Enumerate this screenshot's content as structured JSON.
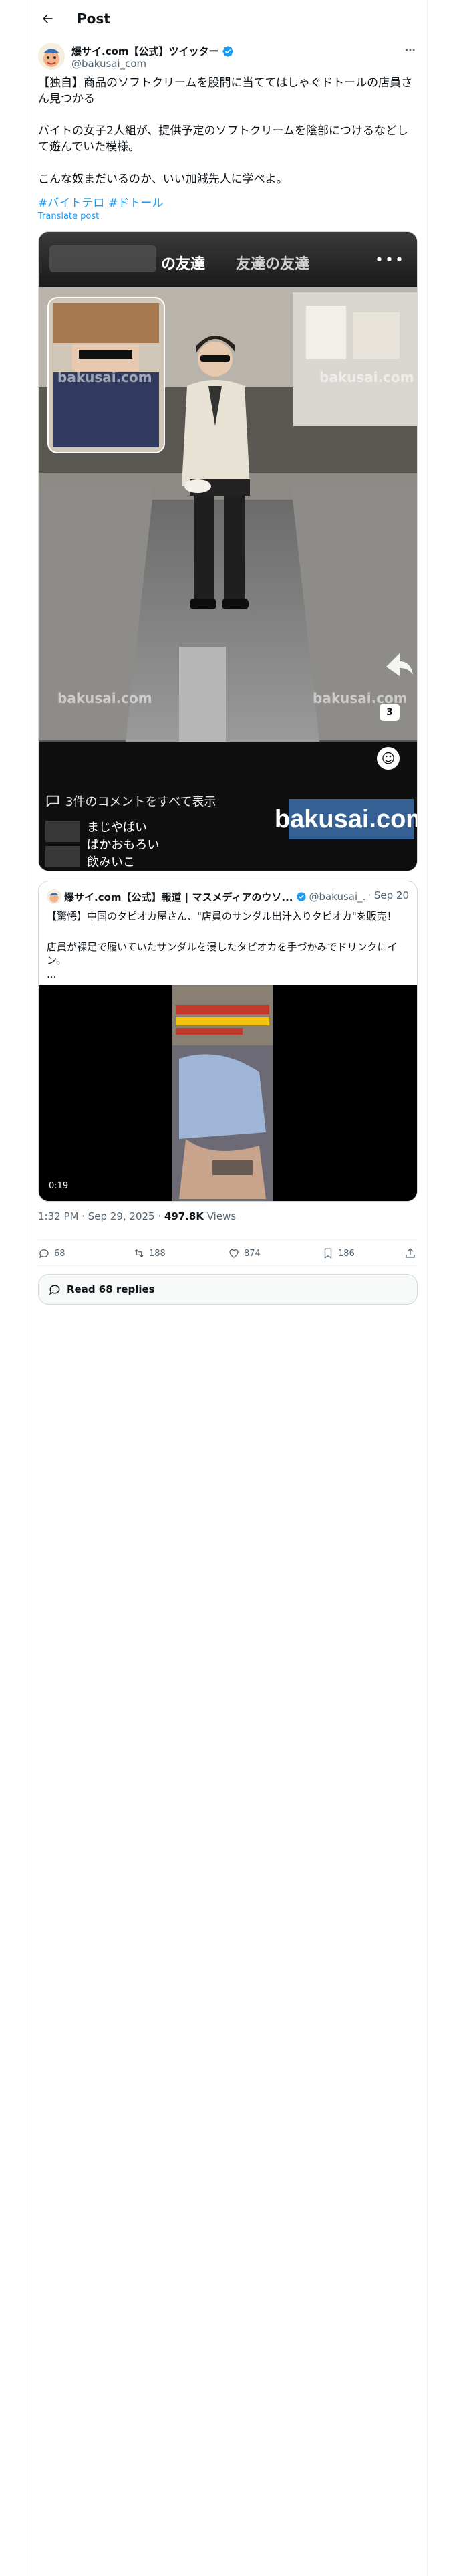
{
  "header": {
    "title": "Post",
    "back_icon": "arrow-left-icon"
  },
  "author": {
    "name": "爆サイ.com【公式】ツイッター",
    "handle": "@bakusai_com",
    "verified": true,
    "verified_color": "#1d9bf0"
  },
  "post": {
    "text": "【独自】商品のソフトクリームを股間に当ててはしゃぐドトールの店員さん見つかる\n\nバイトの女子2人組が、提供予定のソフトクリームを陰部につけるなどして遊んでいた模様。\n\nこんな奴まだいるのか、いい加減先人に学べよ。",
    "hashtags": [
      "#バイトテロ",
      "#ドトール"
    ],
    "translate_label": "Translate post"
  },
  "media": {
    "tab_friends": "の友達",
    "tab_friends_of_friends": "友達の友達",
    "comments_link": "3件のコメントをすべて表示",
    "comments": [
      "まじやばい",
      "ばかおもろい",
      "飲みいこ"
    ],
    "badge_count": "3",
    "watermark": "bakusai.com",
    "watermark_logo": "bakusai.com"
  },
  "quote": {
    "name": "爆サイ.com【公式】報道 | マスメディアのウソ...",
    "handle": "@bakusai_...",
    "date": "· Sep 20",
    "line1": "【驚愕】中国のタピオカ屋さん、\"店員のサンダル出汁入りタピオカ\"を販売！",
    "line2": "店員が裸足で履いていたサンダルを浸したタピオカを手づかみでドリンクにイン。",
    "ellipsis": "...",
    "video_time": "0:19"
  },
  "meta": {
    "time": "1:32 PM · Sep 29, 2025 · ",
    "views": "497.8K",
    "views_label": " Views"
  },
  "actions": {
    "replies": "68",
    "reposts": "188",
    "likes": "874",
    "bookmarks": "186"
  },
  "read_replies": "Read 68 replies"
}
